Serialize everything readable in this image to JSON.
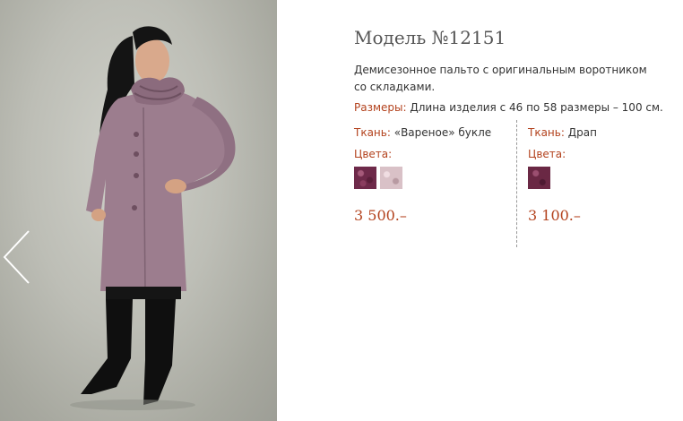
{
  "product": {
    "title": "Модель №12151",
    "description": "Демисезонное пальто с оригинальным воротником со складками.",
    "sizes_label": "Размеры:",
    "sizes_value": " Длина изделия с 46 по 58 размеры – 100 см."
  },
  "variants": [
    {
      "fabric_label": "Ткань:",
      "fabric_value": " «Вареное» букле",
      "colors_label": "Цвета:",
      "swatches": [
        "dark-plum-boucle",
        "light-pink-boucle"
      ],
      "price": "3 500.–"
    },
    {
      "fabric_label": "Ткань:",
      "fabric_value": " Драп",
      "colors_label": "Цвета:",
      "swatches": [
        "plum-drap"
      ],
      "price": "3 100.–"
    }
  ],
  "colors": {
    "accent": "#b3421d",
    "coat": "#9c7d8e"
  }
}
